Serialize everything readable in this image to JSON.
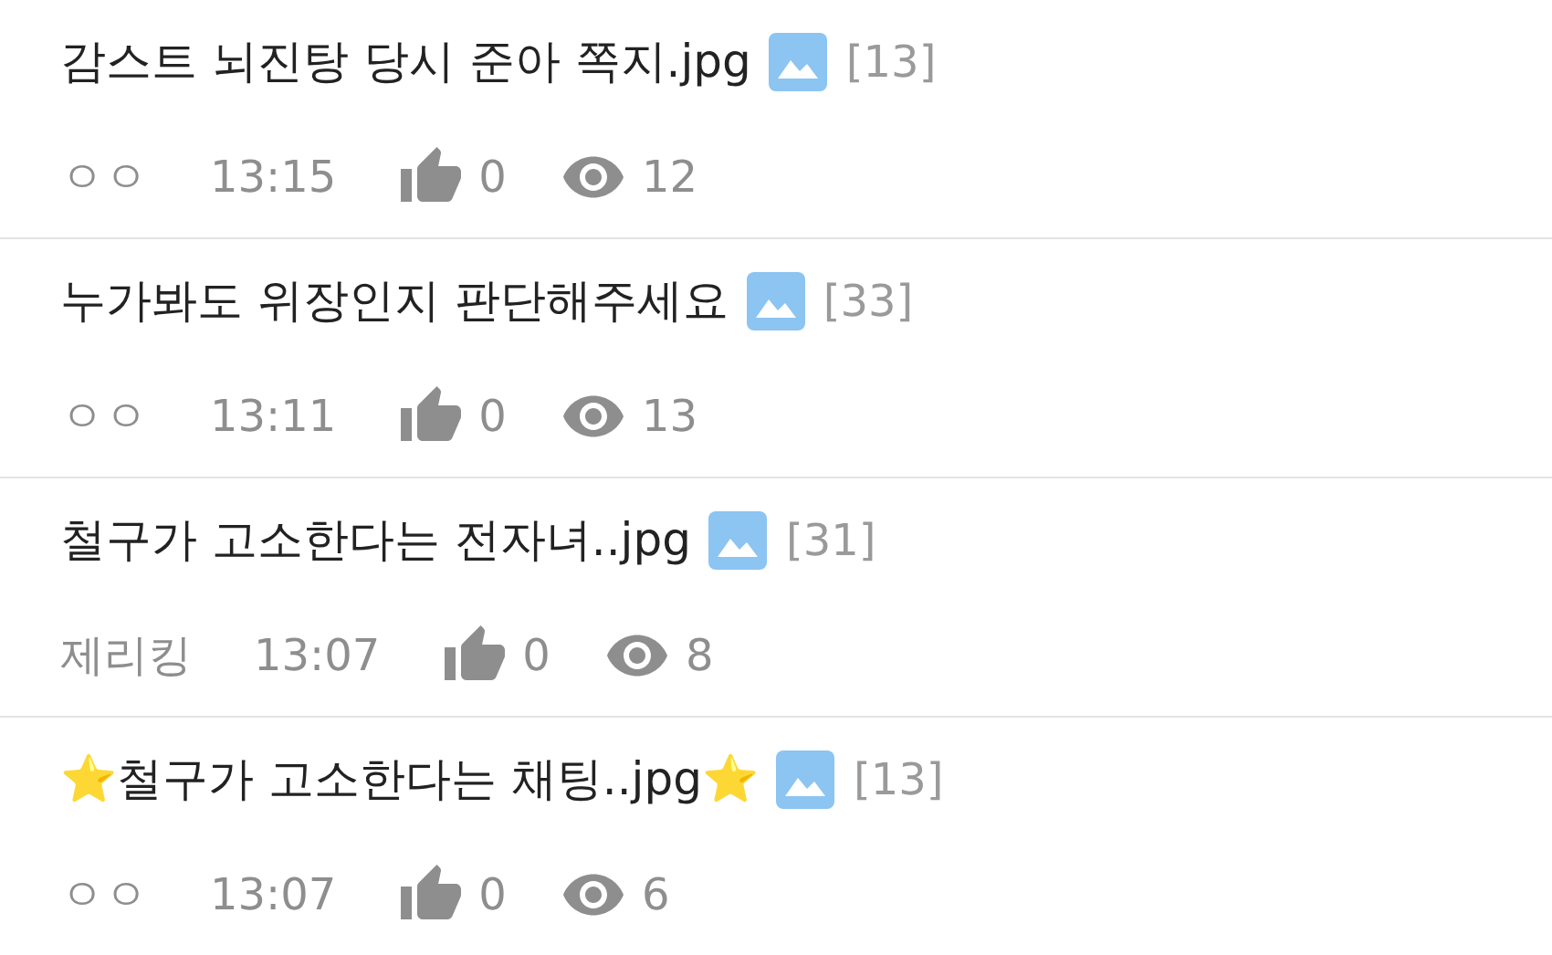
{
  "posts": [
    {
      "title": "감스트 뇌진탕 당시 준아 쪽지.jpg",
      "comments": "[13]",
      "author": "ㅇㅇ",
      "time": "13:15",
      "likes": "0",
      "views": "12"
    },
    {
      "title": "누가봐도 위장인지 판단해주세요",
      "comments": "[33]",
      "author": "ㅇㅇ",
      "time": "13:11",
      "likes": "0",
      "views": "13"
    },
    {
      "title": "철구가 고소한다는 전자녀..jpg",
      "comments": "[31]",
      "author": "제리킹",
      "time": "13:07",
      "likes": "0",
      "views": "8"
    },
    {
      "title": "⭐철구가 고소한다는 채팅..jpg⭐",
      "comments": "[13]",
      "author": "ㅇㅇ",
      "time": "13:07",
      "likes": "0",
      "views": "6"
    }
  ]
}
